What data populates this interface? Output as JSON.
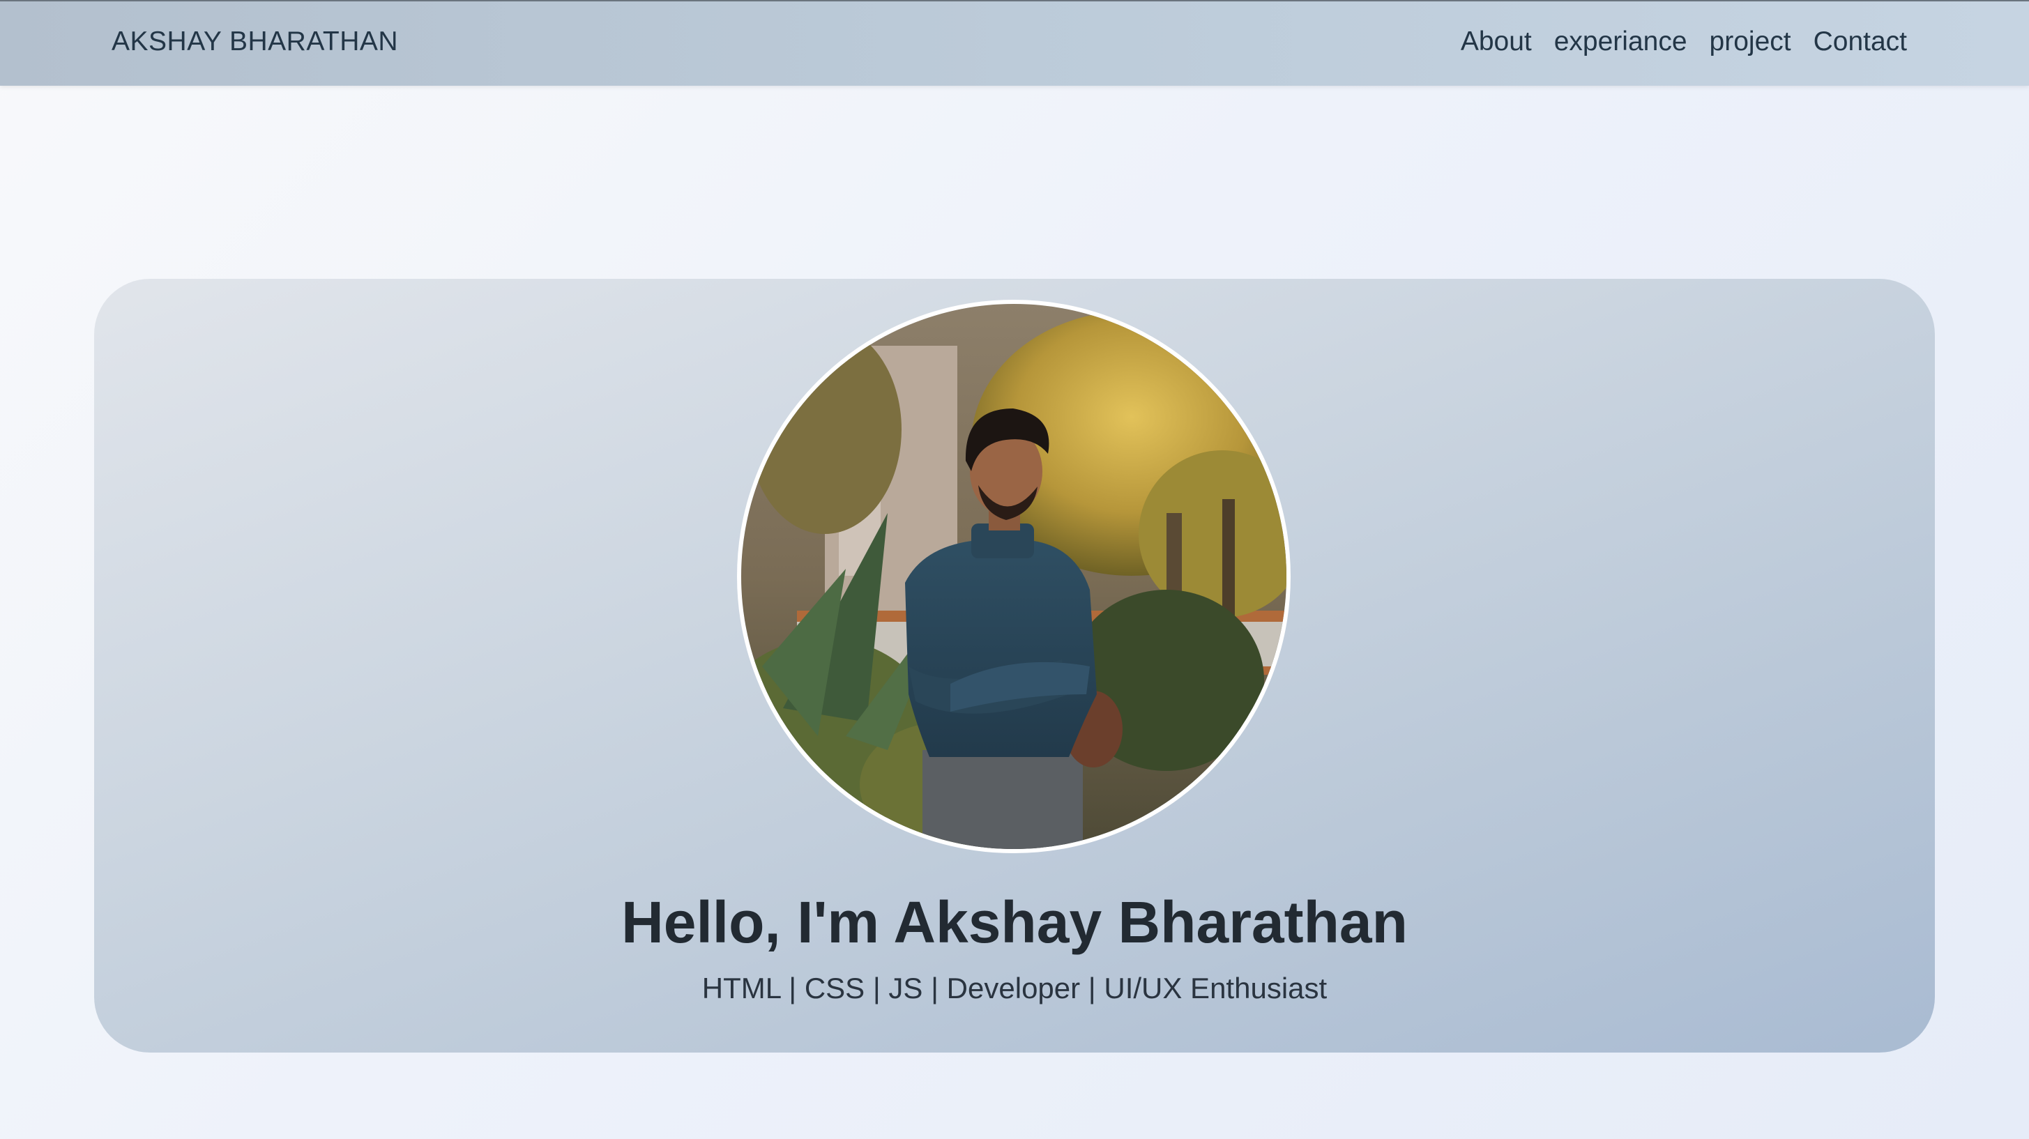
{
  "brand": {
    "name": "AKSHAY BHARATHAN"
  },
  "nav": {
    "items": [
      {
        "label": "About"
      },
      {
        "label": "experiance"
      },
      {
        "label": "project"
      },
      {
        "label": "Contact"
      }
    ]
  },
  "hero": {
    "title": "Hello, I'm Akshay Bharathan",
    "subtitle": "HTML | CSS | JS | Developer | UI/UX Enthusiast",
    "avatar_icon": "profile-photo"
  },
  "colors": {
    "nav_text": "#233647",
    "title_text": "#222a32",
    "avatar_border": "#ffffff"
  }
}
